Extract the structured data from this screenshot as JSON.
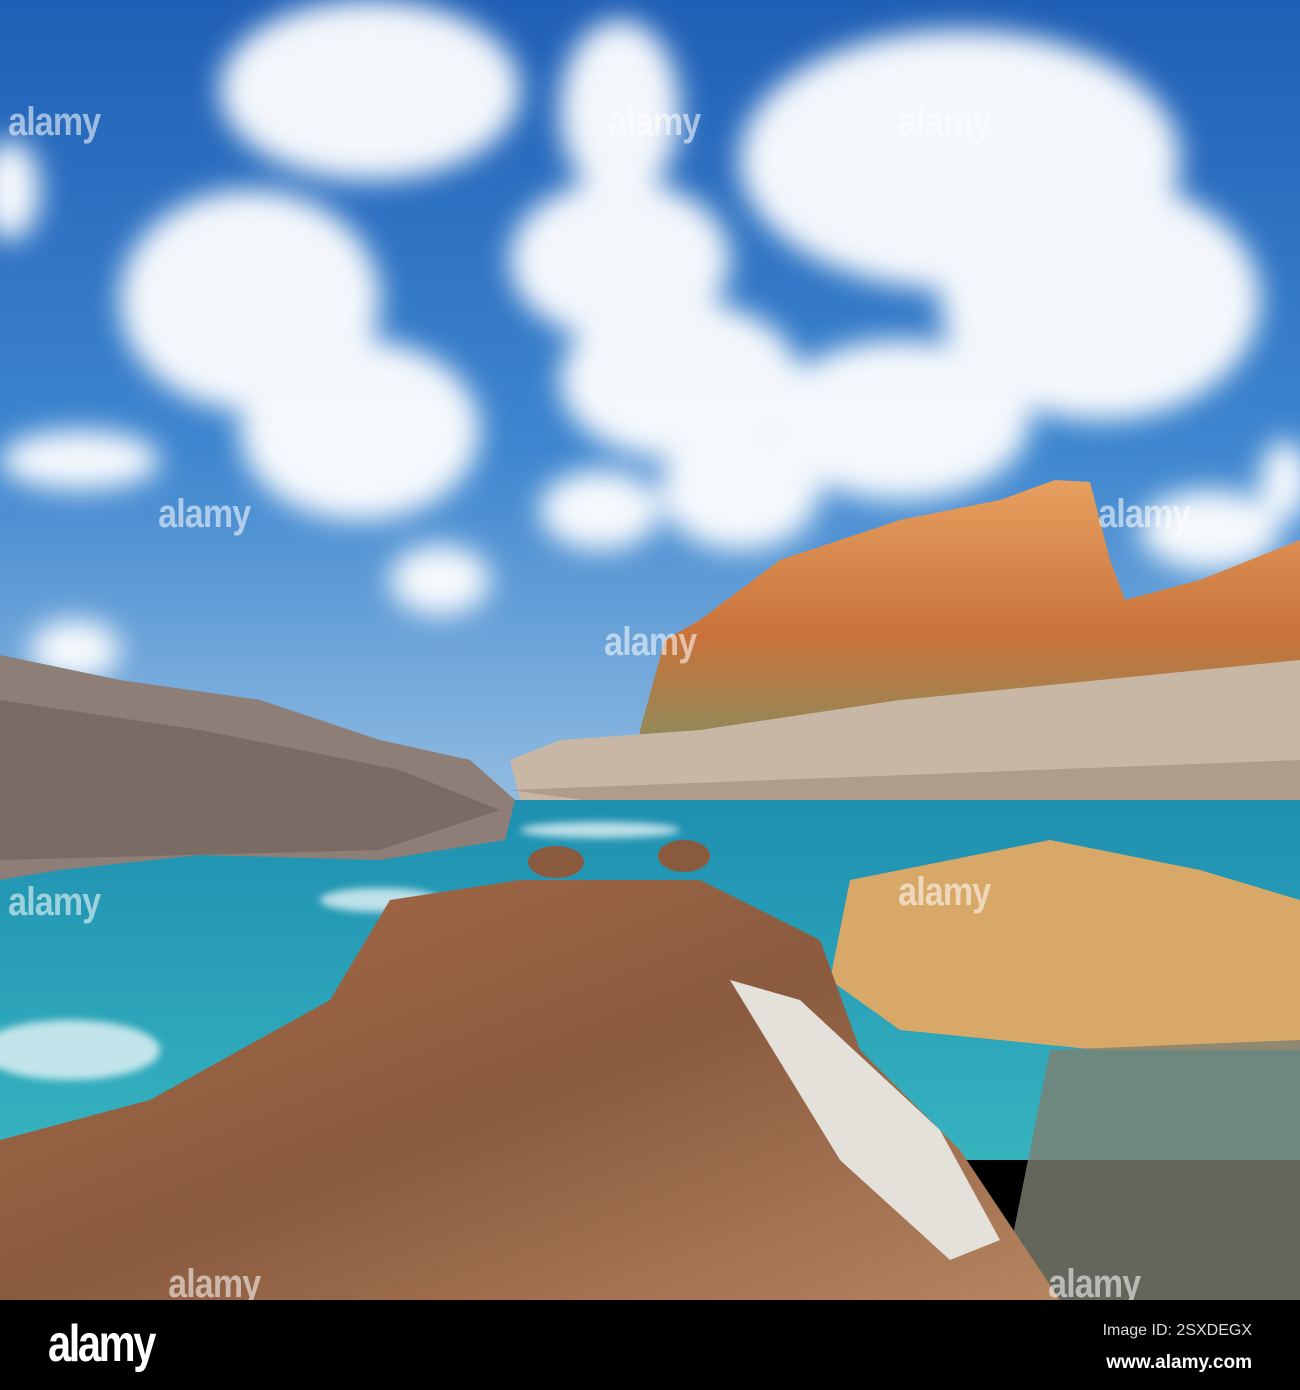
{
  "watermark": {
    "text": "alamy"
  },
  "footer": {
    "logo": "alamy",
    "image_id": "Image ID: 2SXDEGX",
    "website": "www.alamy.com"
  },
  "colors": {
    "sky": "#2f74c4",
    "sea": "#2a9fb8",
    "cliff": "#d98a4a",
    "rock": "#9a6a4c"
  }
}
